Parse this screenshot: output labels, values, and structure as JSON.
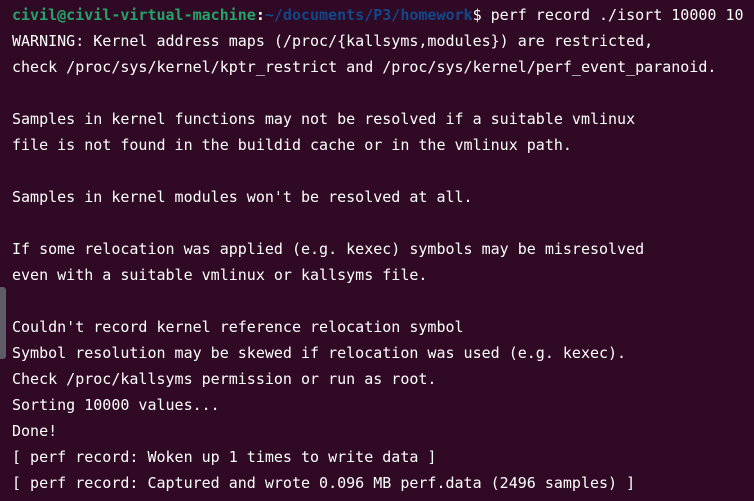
{
  "prompt": {
    "user_host": "civil@civil-virtual-machine",
    "colon": ":",
    "cwd": "~/documents/P3/homework",
    "symbol": "$ ",
    "command": "perf record ./isort 10000 10"
  },
  "output": [
    "WARNING: Kernel address maps (/proc/{kallsyms,modules}) are restricted,",
    "check /proc/sys/kernel/kptr_restrict and /proc/sys/kernel/perf_event_paranoid.",
    "",
    "Samples in kernel functions may not be resolved if a suitable vmlinux",
    "file is not found in the buildid cache or in the vmlinux path.",
    "",
    "Samples in kernel modules won't be resolved at all.",
    "",
    "If some relocation was applied (e.g. kexec) symbols may be misresolved",
    "even with a suitable vmlinux or kallsyms file.",
    "",
    "Couldn't record kernel reference relocation symbol",
    "Symbol resolution may be skewed if relocation was used (e.g. kexec).",
    "Check /proc/kallsyms permission or run as root.",
    "Sorting 10000 values...",
    "Done!",
    "[ perf record: Woken up 1 times to write data ]",
    "[ perf record: Captured and wrote 0.096 MB perf.data (2496 samples) ]"
  ],
  "colors": {
    "background": "#300a24",
    "user_host": "#26a269",
    "cwd": "#12488b",
    "text": "#ffffff"
  }
}
